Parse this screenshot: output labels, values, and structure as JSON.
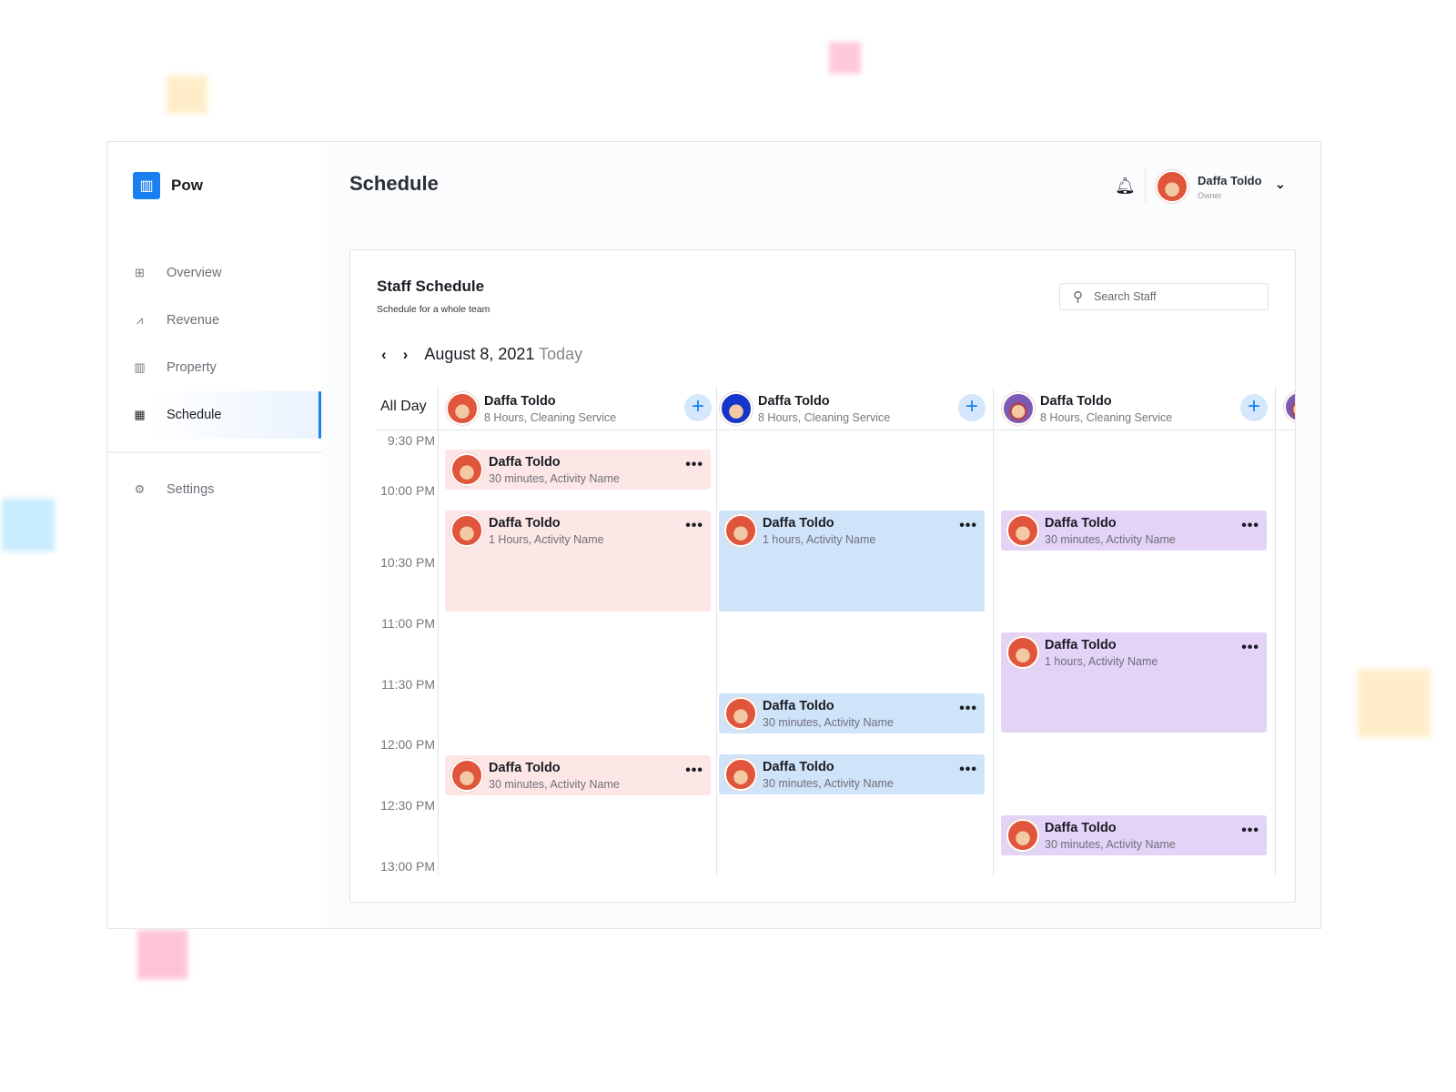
{
  "app": {
    "name": "Pow",
    "page_title": "Schedule"
  },
  "sidebar": {
    "items": [
      {
        "label": "Overview",
        "icon": "grid-icon"
      },
      {
        "label": "Revenue",
        "icon": "chart-icon"
      },
      {
        "label": "Property",
        "icon": "building-icon"
      },
      {
        "label": "Schedule",
        "icon": "calendar-icon",
        "active": true
      },
      {
        "label": "Settings",
        "icon": "gear-icon"
      }
    ]
  },
  "user": {
    "name": "Daffa Toldo",
    "role": "Owner"
  },
  "card": {
    "title": "Staff Schedule",
    "subtitle": "Schedule for a whole team",
    "search_placeholder": "Search Staff"
  },
  "date": {
    "label": "August 8, 2021",
    "today": "Today"
  },
  "all_day": "All Day",
  "times": [
    "9:30 PM",
    "10:00 PM",
    "10:30 PM",
    "11:00 PM",
    "11:30 PM",
    "12:00 PM",
    "12:30 PM",
    "13:00 PM"
  ],
  "colors": {
    "accent": "#1a7ff0",
    "pink": "#fde7e6",
    "blue": "#cfe3f9",
    "purple": "#e2d3f7"
  },
  "staff": [
    {
      "name": "Daffa Toldo",
      "detail": "8 Hours, Cleaning Service",
      "events": [
        {
          "name": "Daffa Toldo",
          "detail": "30 minutes, Activity Name"
        },
        {
          "name": "Daffa Toldo",
          "detail": "1 Hours, Activity Name"
        },
        {
          "name": "Daffa Toldo",
          "detail": "30 minutes, Activity Name"
        }
      ]
    },
    {
      "name": "Daffa Toldo",
      "detail": "8 Hours, Cleaning Service",
      "events": [
        {
          "name": "Daffa Toldo",
          "detail": "1 hours, Activity Name"
        },
        {
          "name": "Daffa Toldo",
          "detail": "30 minutes, Activity Name"
        },
        {
          "name": "Daffa Toldo",
          "detail": "30 minutes, Activity Name"
        }
      ]
    },
    {
      "name": "Daffa Toldo",
      "detail": "8 Hours, Cleaning Service",
      "events": [
        {
          "name": "Daffa Toldo",
          "detail": "30 minutes, Activity Name"
        },
        {
          "name": "Daffa Toldo",
          "detail": "1 hours, Activity Name"
        },
        {
          "name": "Daffa Toldo",
          "detail": "30 minutes, Activity Name"
        }
      ]
    }
  ]
}
